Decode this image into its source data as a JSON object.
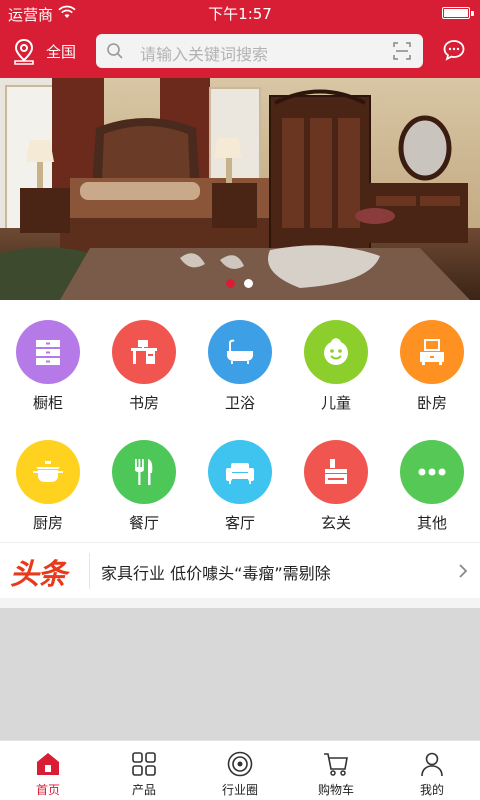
{
  "status_bar": {
    "carrier": "运营商",
    "time": "下午1:57"
  },
  "header": {
    "location": "全国",
    "search_placeholder": "请输入关键词搜索"
  },
  "banner": {
    "image": "bedroom-furniture-photo",
    "dot_count": 2,
    "active_dot": 0
  },
  "categories": [
    {
      "label": "橱柜",
      "color": "#b57ae8",
      "icon": "cabinet-icon"
    },
    {
      "label": "书房",
      "color": "#f0554f",
      "icon": "desk-icon"
    },
    {
      "label": "卫浴",
      "color": "#3d9fe6",
      "icon": "bathtub-icon"
    },
    {
      "label": "儿童",
      "color": "#8ccf2c",
      "icon": "child-face-icon"
    },
    {
      "label": "卧房",
      "color": "#ff9022",
      "icon": "dresser-icon"
    },
    {
      "label": "厨房",
      "color": "#ffd21f",
      "icon": "pot-icon"
    },
    {
      "label": "餐厅",
      "color": "#4ec759",
      "icon": "fork-knife-icon"
    },
    {
      "label": "客厅",
      "color": "#3fc3ef",
      "icon": "sofa-icon"
    },
    {
      "label": "玄关",
      "color": "#f0554f",
      "icon": "entryway-icon"
    },
    {
      "label": "其他",
      "color": "#56c856",
      "icon": "more-dots-icon"
    }
  ],
  "news": {
    "badge": "头条",
    "headline": "家具行业 低价噱头“毒瘤”需剔除"
  },
  "tabs": [
    {
      "label": "首页",
      "icon": "home-icon",
      "active": true
    },
    {
      "label": "产品",
      "icon": "grid-icon",
      "active": false
    },
    {
      "label": "行业圈",
      "icon": "circle-icon",
      "active": false
    },
    {
      "label": "购物车",
      "icon": "cart-icon",
      "active": false
    },
    {
      "label": "我的",
      "icon": "user-icon",
      "active": false
    }
  ],
  "colors": {
    "brand": "#d81e34",
    "active_tab": "#d81e34",
    "news_badge": "#e8391c"
  }
}
